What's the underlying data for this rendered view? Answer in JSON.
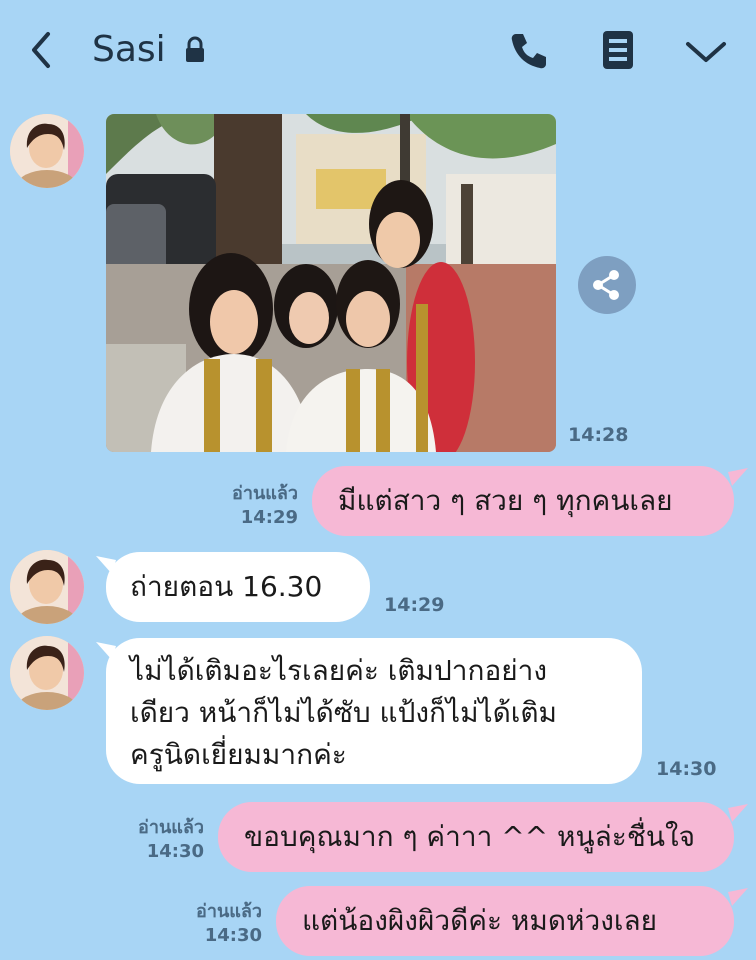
{
  "header": {
    "contact_name": "Sasi",
    "icons": [
      "back-chevron-icon",
      "lock-icon",
      "phone-icon",
      "notes-icon",
      "chevron-down-icon"
    ]
  },
  "messages": [
    {
      "type": "photo",
      "time": "14:28"
    },
    {
      "type": "text",
      "direction": "out",
      "read_label": "อ่านแล้ว",
      "time": "14:29",
      "text": "มีแต่สาว ๆ สวย ๆ ทุกคนเลย"
    },
    {
      "type": "text",
      "direction": "in",
      "time": "14:29",
      "text": "ถ่ายตอน 16.30"
    },
    {
      "type": "text",
      "direction": "in",
      "time": "14:30",
      "lines": [
        "ไม่ได้เติมอะไรเลยค่ะ เติมปากอย่าง",
        "เดียว หน้าก็ไม่ได้ซับ แป้งก็ไม่ได้เติม",
        "ครูนิดเยี่ยมมากค่ะ"
      ]
    },
    {
      "type": "text",
      "direction": "out",
      "read_label": "อ่านแล้ว",
      "time": "14:30",
      "text": "ขอบคุณมาก ๆ ค่าาา ^^ หนูล่ะชื่นใจ"
    },
    {
      "type": "text",
      "direction": "out",
      "read_label": "อ่านแล้ว",
      "time": "14:30",
      "text": "แต่น้องผิงผิวดีค่ะ หมดห่วงเลย"
    }
  ],
  "colors": {
    "background": "#a8d5f5",
    "outgoing": "#f6b8d5",
    "incoming": "#ffffff",
    "icon": "#1f3345"
  }
}
